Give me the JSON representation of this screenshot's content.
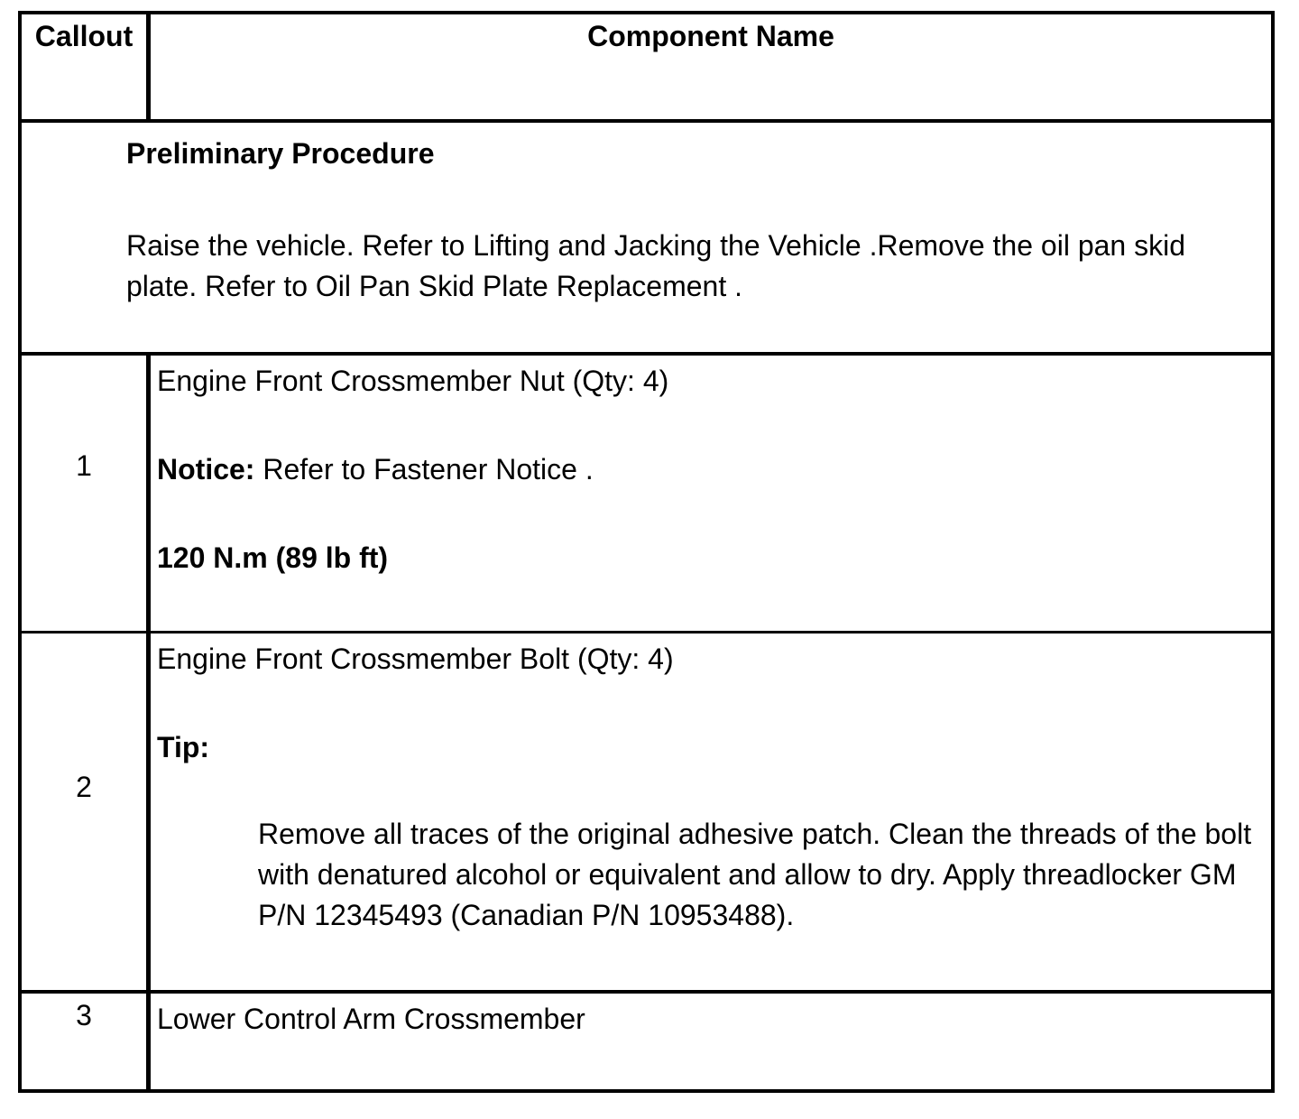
{
  "header": {
    "callout": "Callout",
    "component_name": "Component Name"
  },
  "preliminary": {
    "title": "Preliminary Procedure",
    "text": "Raise the vehicle. Refer to Lifting and Jacking the Vehicle .Remove the oil pan skid plate. Refer to Oil Pan Skid Plate Replacement ."
  },
  "rows": [
    {
      "callout": "1",
      "name": "Engine Front Crossmember Nut (Qty: 4)",
      "notice_label": "Notice:",
      "notice_text": " Refer to Fastener Notice .",
      "torque": "120 N.m (89 lb ft)"
    },
    {
      "callout": "2",
      "name": "Engine Front Crossmember Bolt (Qty: 4)",
      "tip_label": "Tip:",
      "tip_text": "Remove all traces of the original adhesive patch. Clean the threads of the bolt with denatured alcohol or equivalent and allow to dry. Apply threadlocker GM P/N 12345493 (Canadian P/N 10953488)."
    },
    {
      "callout": "3",
      "name": "Lower Control Arm Crossmember"
    }
  ]
}
